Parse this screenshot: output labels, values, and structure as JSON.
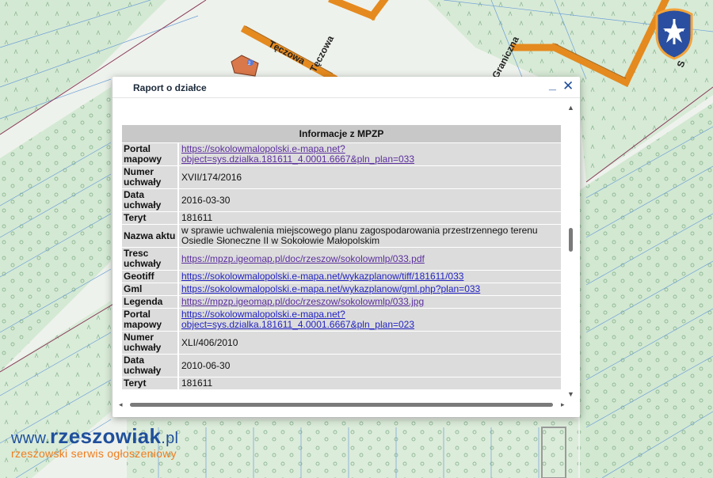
{
  "map": {
    "street_labels": [
      "Tęczowa",
      "Tęczowa",
      "Graniczna",
      "S"
    ],
    "parcel_marker": "2"
  },
  "dialog": {
    "title": "Raport o działce",
    "minimize_label": "_",
    "close_label": "✕",
    "section_title": "Informacje z MPZP",
    "rows": [
      {
        "key": "Portal mapowy",
        "value": "https://sokolowmalopolski.e-mapa.net?object=sys.dzialka.181611_4.0001.6667&pln_plan=033",
        "link": true,
        "visited": true
      },
      {
        "key": "Numer uchwały",
        "value": "XVII/174/2016",
        "link": false
      },
      {
        "key": "Data uchwały",
        "value": "2016-03-30",
        "link": false
      },
      {
        "key": "Teryt",
        "value": "181611",
        "link": false
      },
      {
        "key": "Nazwa aktu",
        "value": "w sprawie uchwalenia miejscowego planu zagospodarowania przestrzennego terenu Osiedle Słoneczne II w Sokołowie Małopolskim",
        "link": false
      },
      {
        "key": "Tresc uchwały",
        "value": "https://mpzp.igeomap.pl/doc/rzeszow/sokolowmlp/033.pdf",
        "link": true,
        "visited": true
      },
      {
        "key": "Geotiff",
        "value": "https://sokolowmalopolski.e-mapa.net/wykazplanow/tiff/181611/033",
        "link": true,
        "visited": false
      },
      {
        "key": "Gml",
        "value": "https://sokolowmalopolski.e-mapa.net/wykazplanow/gml.php?plan=033",
        "link": true,
        "visited": false
      },
      {
        "key": "Legenda",
        "value": "https://mpzp.igeomap.pl/doc/rzeszow/sokolowmlp/033.jpg",
        "link": true,
        "visited": true
      },
      {
        "key": "Portal mapowy",
        "value": "https://sokolowmalopolski.e-mapa.net?object=sys.dzialka.181611_4.0001.6667&pln_plan=023",
        "link": true,
        "visited": false
      },
      {
        "key": "Numer uchwały",
        "value": "XLI/406/2010",
        "link": false
      },
      {
        "key": "Data uchwały",
        "value": "2010-06-30",
        "link": false
      },
      {
        "key": "Teryt",
        "value": "181611",
        "link": false
      }
    ]
  },
  "watermark": {
    "prefix": "www.",
    "brand": "rzeszowiak",
    "suffix": ".pl",
    "tagline": "rzeszowski serwis ogłoszeniowy"
  },
  "colors": {
    "map_background": "#eef2ec",
    "forest_fill": "#cfe6cf",
    "road_fill": "#e58a1f",
    "link_visited": "#5b2f9d",
    "link_blue": "#2323c2",
    "brand_blue": "#1f4f9c",
    "brand_orange": "#f07c1d"
  }
}
